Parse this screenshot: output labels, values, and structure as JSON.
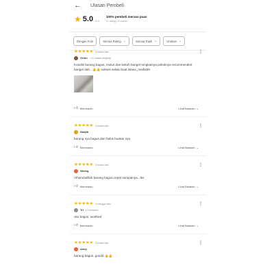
{
  "header": {
    "back_icon": "arrow-left-icon",
    "title": "Ulasan Pembeli"
  },
  "summary": {
    "rating": "5.0",
    "rating_max": "/ 5.0",
    "headline": "100% pembeli merasa puas",
    "counts": "21 rating • 6 ulasan",
    "star_color": "#f5b400"
  },
  "filters": [
    {
      "label": "Dengan Foto",
      "dropdown": false
    },
    {
      "label": "Semua Rating",
      "dropdown": true
    },
    {
      "label": "Semua Topik",
      "dropdown": true
    },
    {
      "label": "Urutkan",
      "dropdown": true
    }
  ],
  "reviews": [
    {
      "stars": 5,
      "time": "3 bulan lalu",
      "user": "Orion",
      "badge": "• 10 ulasan lengkap",
      "avatar_color": "#7d5b3e",
      "text": "Kondisi barang bagus, mulus dan kokoh banget tongkatnya pokoknya recommended banget dah.. 👍👍 sukses selalu buat istana_medis99",
      "has_photo": true
    },
    {
      "stars": 5,
      "time": "4 bulan lalu",
      "user": "Nadjib",
      "badge": "",
      "avatar_color": "#e0a11b",
      "text": "barang nya bagus dan halus buatan nya",
      "has_photo": false
    },
    {
      "stars": 5,
      "time": "3 bulan lalu",
      "user": "Nining",
      "badge": "",
      "avatar_color": "#e8653a",
      "text": "Alhamdulillah barang bagus,cepet sampainya...tks",
      "has_photo": false
    },
    {
      "stars": 5,
      "time": "4 minggu lalu",
      "user": "Tri",
      "badge": "• 3 terbantu",
      "avatar_color": "#8a8f98",
      "text": "oke bagus. worthed",
      "has_photo": false
    },
    {
      "stars": 5,
      "time": "4 bulan lalu",
      "user": "Asep",
      "badge": "",
      "avatar_color": "#e8653a",
      "text": "barang bagus. goodd 👍👍",
      "has_photo": false
    }
  ],
  "actions": {
    "helpful_label": "Membantu",
    "replies_label": "Lihat Balasan"
  },
  "icons": {
    "more": "more-vertical-icon",
    "like": "thumbs-up-icon",
    "expand": "chevron-down-icon"
  }
}
